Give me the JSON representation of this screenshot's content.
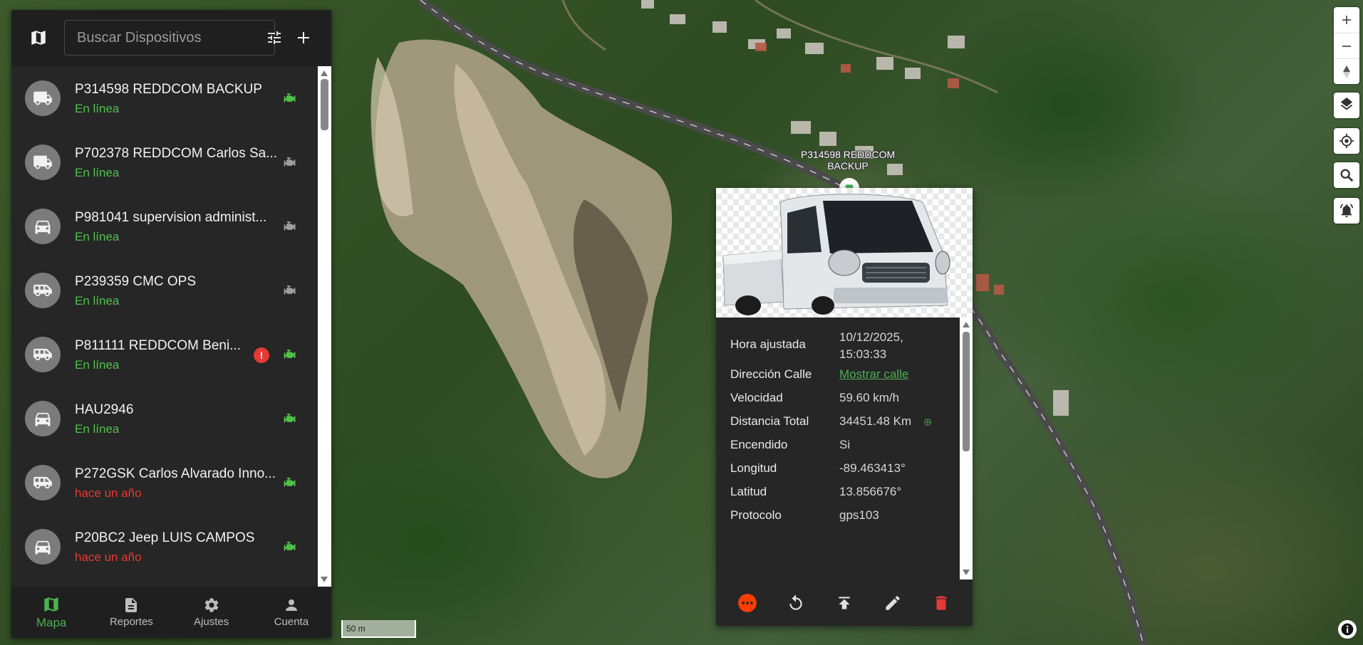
{
  "search": {
    "placeholder": "Buscar Dispositivos"
  },
  "devices": [
    {
      "name": "P314598 REDDCOM BACKUP",
      "status": "En línea",
      "status_kind": "online",
      "icon": "truck-icon",
      "engine_on": true,
      "alert": false
    },
    {
      "name": "P702378 REDDCOM Carlos Sa...",
      "status": "En línea",
      "status_kind": "online",
      "icon": "truck-icon",
      "engine_on": false,
      "alert": false
    },
    {
      "name": "P981041 supervision administ...",
      "status": "En línea",
      "status_kind": "online",
      "icon": "car-icon",
      "engine_on": false,
      "alert": false
    },
    {
      "name": "P239359 CMC OPS",
      "status": "En línea",
      "status_kind": "online",
      "icon": "van-icon",
      "engine_on": false,
      "alert": false
    },
    {
      "name": "P811111 REDDCOM Beni...",
      "status": "En línea",
      "status_kind": "online",
      "icon": "van-icon",
      "engine_on": true,
      "alert": true
    },
    {
      "name": "HAU2946",
      "status": "En línea",
      "status_kind": "online",
      "icon": "car-icon",
      "engine_on": true,
      "alert": false
    },
    {
      "name": "P272GSK Carlos Alvarado Inno...",
      "status": "hace un año",
      "status_kind": "offline",
      "icon": "van-icon",
      "engine_on": true,
      "alert": false
    },
    {
      "name": "P20BC2 Jeep LUIS CAMPOS",
      "status": "hace un año",
      "status_kind": "offline",
      "icon": "car-icon",
      "engine_on": true,
      "alert": false
    }
  ],
  "nav": {
    "map": "Mapa",
    "reports": "Reportes",
    "settings": "Ajustes",
    "account": "Cuenta"
  },
  "map": {
    "scale": "50 m",
    "marker_label": "P314598 REDDCOM BACKUP"
  },
  "popup": {
    "rows": [
      {
        "key": "Hora ajustada",
        "value": "10/12/2025, 15:03:33"
      },
      {
        "key": "Dirección Calle",
        "value": "Mostrar calle",
        "link": true
      },
      {
        "key": "Velocidad",
        "value": "59.60 km/h"
      },
      {
        "key": "Distancia Total",
        "value": "34451.48 Km"
      },
      {
        "key": "Encendido",
        "value": "Si"
      },
      {
        "key": "Longitud",
        "value": "-89.463413°"
      },
      {
        "key": "Latitud",
        "value": "13.856676°"
      },
      {
        "key": "Protocolo",
        "value": "gps103"
      }
    ]
  },
  "colors": {
    "online": "#4fc04a",
    "offline": "#e53935",
    "accent": "#4caf50",
    "panel": "#262626",
    "danger": "#e53935",
    "more": "#ff3d00"
  }
}
